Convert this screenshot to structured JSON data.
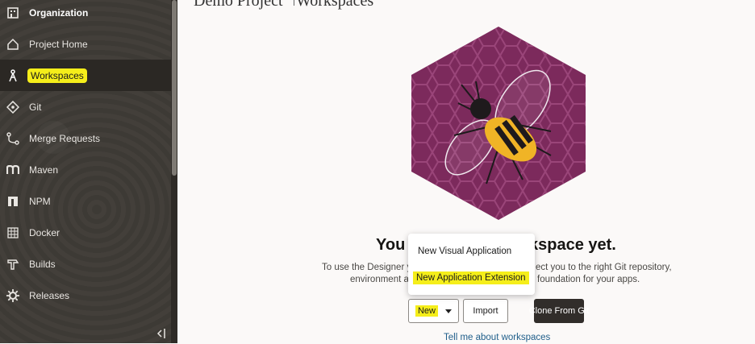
{
  "sidebar": {
    "items": [
      {
        "label": "Organization",
        "icon": "building-icon"
      },
      {
        "label": "Project Home",
        "icon": "home-icon"
      },
      {
        "label": "Workspaces",
        "icon": "workspaces-icon"
      },
      {
        "label": "Git",
        "icon": "git-icon"
      },
      {
        "label": "Merge Requests",
        "icon": "merge-icon"
      },
      {
        "label": "Maven",
        "icon": "maven-icon"
      },
      {
        "label": "NPM",
        "icon": "npm-icon"
      },
      {
        "label": "Docker",
        "icon": "docker-icon"
      },
      {
        "label": "Builds",
        "icon": "builds-icon"
      },
      {
        "label": "Releases",
        "icon": "gear-icon"
      }
    ],
    "active_index": 2
  },
  "header": {
    "project": "Demo Project",
    "section": "Workspaces"
  },
  "empty_state": {
    "heading_left": "You",
    "heading_right": "kspace yet.",
    "desc_line1_left": "To use the Designer y",
    "desc_line1_right": "ect you to the right Git repository,",
    "desc_line2_left": "environment a",
    "desc_line2_right": "foundation for your apps.",
    "link": "Tell me about workspaces"
  },
  "buttons": {
    "new": "New",
    "import": "Import",
    "clone": "Clone From Git"
  },
  "dropdown": {
    "items": [
      "New Visual Application",
      "New Application Extension"
    ],
    "highlighted_index": 1
  },
  "colors": {
    "highlight": "#f5ee1a",
    "hex_bg": "#7c2a5c",
    "sidebar_bg": "#3d3a35"
  }
}
